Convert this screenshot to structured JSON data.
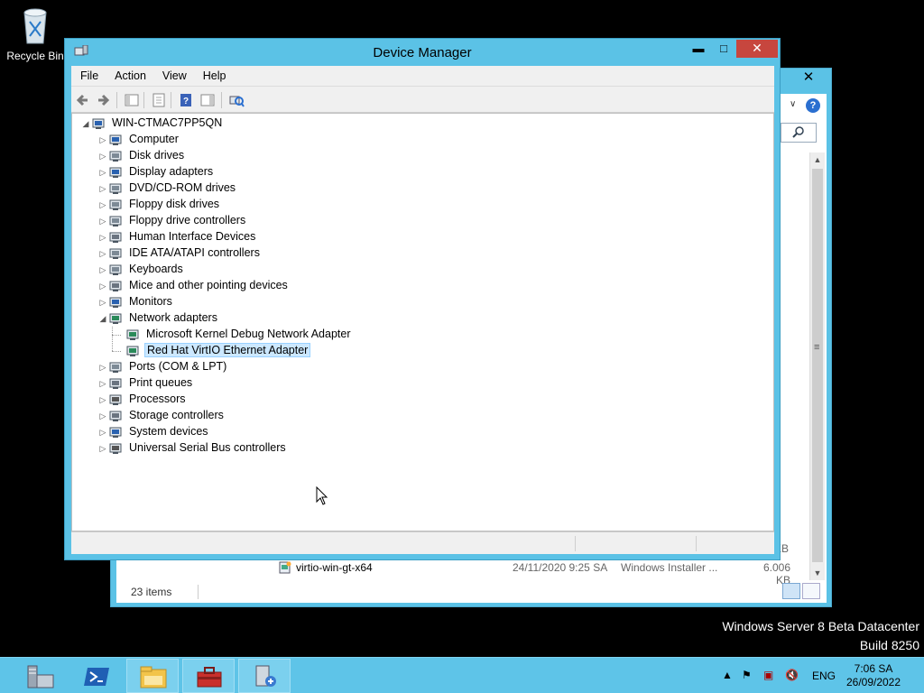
{
  "desktop": {
    "recycle_bin": "Recycle Bin",
    "watermark_line1": "Windows Server 8 Beta Datacenter",
    "watermark_line2": "Build 8250"
  },
  "explorer": {
    "close_glyph": "✕",
    "file": {
      "name": "virtio-win-gt-x64",
      "date": "24/11/2020 9:25 SA",
      "type": "Windows Installer ...",
      "size": "6.006 KB"
    },
    "partial_size": "KB",
    "items_count": "23 items"
  },
  "device_manager": {
    "title": "Device Manager",
    "menu": [
      "File",
      "Action",
      "View",
      "Help"
    ],
    "root": "WIN-CTMAC7PP5QN",
    "categories": [
      {
        "label": "Computer",
        "icon": "computer-icon"
      },
      {
        "label": "Disk drives",
        "icon": "disk-drive-icon"
      },
      {
        "label": "Display adapters",
        "icon": "display-adapter-icon"
      },
      {
        "label": "DVD/CD-ROM drives",
        "icon": "dvd-drive-icon"
      },
      {
        "label": "Floppy disk drives",
        "icon": "floppy-drive-icon"
      },
      {
        "label": "Floppy drive controllers",
        "icon": "floppy-controller-icon"
      },
      {
        "label": "Human Interface Devices",
        "icon": "hid-icon"
      },
      {
        "label": "IDE ATA/ATAPI controllers",
        "icon": "ide-controller-icon"
      },
      {
        "label": "Keyboards",
        "icon": "keyboard-icon"
      },
      {
        "label": "Mice and other pointing devices",
        "icon": "mouse-icon"
      },
      {
        "label": "Monitors",
        "icon": "monitor-icon"
      },
      {
        "label": "Network adapters",
        "icon": "network-adapter-icon",
        "expanded": true,
        "children": [
          "Microsoft Kernel Debug Network Adapter",
          "Red Hat VirtIO Ethernet Adapter"
        ]
      },
      {
        "label": "Ports (COM & LPT)",
        "icon": "port-icon"
      },
      {
        "label": "Print queues",
        "icon": "printer-icon"
      },
      {
        "label": "Processors",
        "icon": "processor-icon"
      },
      {
        "label": "Storage controllers",
        "icon": "storage-controller-icon"
      },
      {
        "label": "System devices",
        "icon": "system-device-icon"
      },
      {
        "label": "Universal Serial Bus controllers",
        "icon": "usb-icon"
      }
    ],
    "selected": "Red Hat VirtIO Ethernet Adapter"
  },
  "taskbar": {
    "apps": [
      "server-manager-icon",
      "powershell-icon",
      "file-explorer-icon",
      "toolbox-icon",
      "device-manager-icon"
    ],
    "language": "ENG",
    "time": "7:06 SA",
    "date": "26/09/2022"
  },
  "colors": {
    "accent": "#5bc2e6",
    "close_red": "#c7463e",
    "selection": "#cce8ff"
  }
}
